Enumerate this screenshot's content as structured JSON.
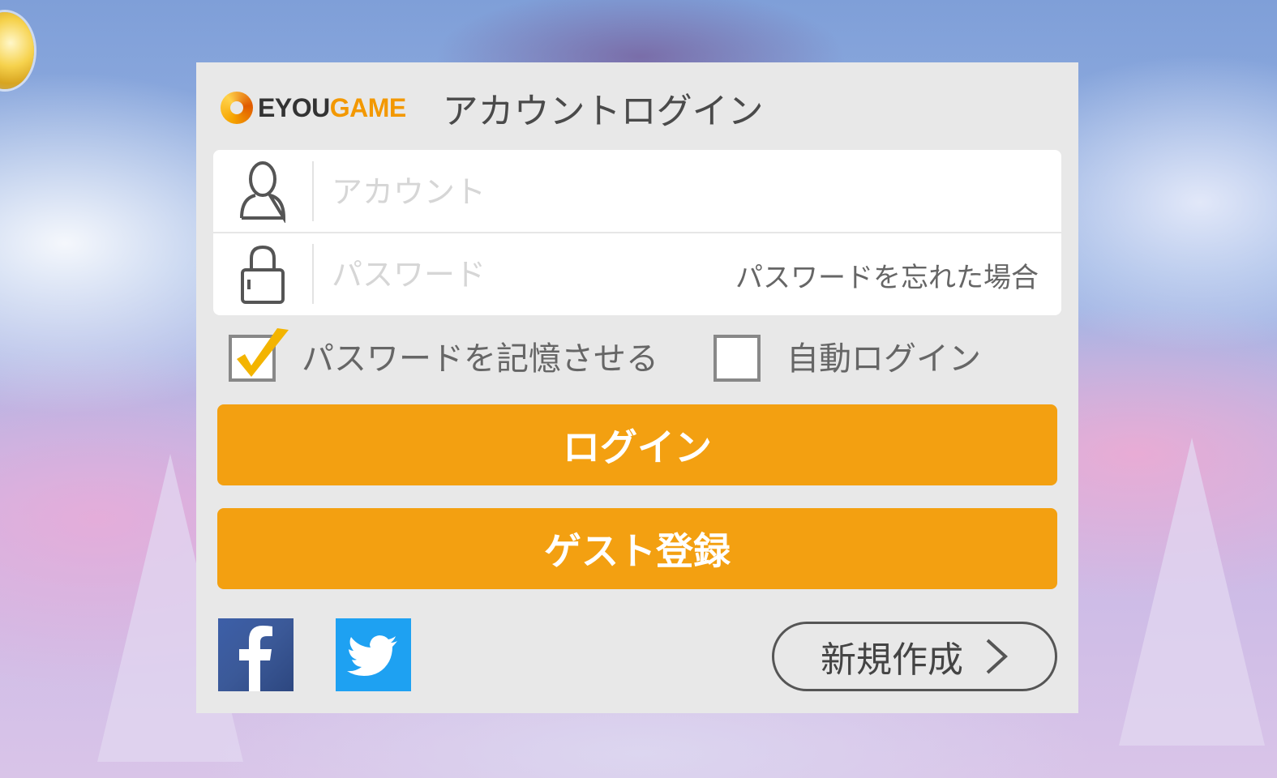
{
  "brand": {
    "name_part1": "EYOU",
    "name_part2": "GAME",
    "accent_color": "#f39800"
  },
  "dialog": {
    "title": "アカウントログイン"
  },
  "form": {
    "account": {
      "placeholder": "アカウント",
      "value": "",
      "icon": "user-icon"
    },
    "password": {
      "placeholder": "パスワード",
      "value": "",
      "icon": "lock-icon"
    },
    "forgot_link": "パスワードを忘れた場合"
  },
  "options": {
    "remember_password": {
      "label": "パスワードを記憶させる",
      "checked": true
    },
    "auto_login": {
      "label": "自動ログイン",
      "checked": false
    }
  },
  "buttons": {
    "login": "ログイン",
    "guest_register": "ゲスト登録",
    "create_new": "新規作成",
    "color": "#f3a011"
  },
  "social": {
    "facebook": {
      "icon": "facebook-icon",
      "color": "#3b5998"
    },
    "twitter": {
      "icon": "twitter-icon",
      "color": "#1ea1f2"
    }
  }
}
